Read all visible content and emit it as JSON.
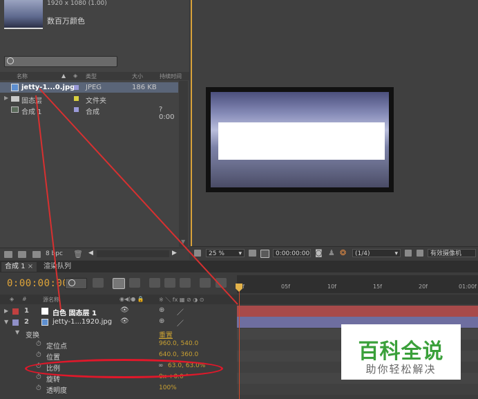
{
  "project": {
    "thumb_info": "1920 x 1080 (1.00)",
    "thumb_colors": "数百万颜色",
    "columns": [
      "名称",
      "类型",
      "大小",
      "持续时间"
    ],
    "items": [
      {
        "name": "jetty-1...0.jpg",
        "type": "JPEG",
        "size": "186 KB",
        "duration": ""
      },
      {
        "name": "固态层",
        "type": "文件夹",
        "size": "",
        "duration": ""
      },
      {
        "name": "合成 1",
        "type": "合成",
        "size": "",
        "duration": "? 0:00"
      }
    ],
    "bpc": "8 bpc",
    "colors": {
      "jpeg": "#9a9ad8",
      "folder": "#d8d040",
      "comp": "#9a9ad8"
    }
  },
  "viewer": {
    "zoom": "25 %",
    "timecode": "0:00:00:00",
    "resolution": "(1/4)",
    "camera": "有效摄像机"
  },
  "timeline": {
    "tabs": [
      "合成 1",
      "渲染队列"
    ],
    "timecode": "0:00:00:00",
    "ruler_ticks": [
      "0f",
      "05f",
      "10f",
      "15f",
      "20f",
      "01:00f"
    ],
    "layer_header": "源名称",
    "layers": [
      {
        "num": "1",
        "name": "白色 固态层 1",
        "color": "#c04040",
        "track": "#a84a4a"
      },
      {
        "num": "2",
        "name": "jetty-1...1920.jpg",
        "color": "#9090c8",
        "track": "#6e6ea0"
      }
    ],
    "transform": {
      "label": "变换",
      "reset": "重置"
    },
    "props": [
      {
        "name": "定位点",
        "value": "960.0, 540.0"
      },
      {
        "name": "位置",
        "value": "640.0, 360.0"
      },
      {
        "name": "比例",
        "value": "63.0, 63.0%"
      },
      {
        "name": "旋转",
        "value": "0x +0.0 °"
      },
      {
        "name": "透明度",
        "value": "100%"
      }
    ]
  },
  "watermark": {
    "title": "百科全说",
    "subtitle": "助你轻松解决"
  }
}
